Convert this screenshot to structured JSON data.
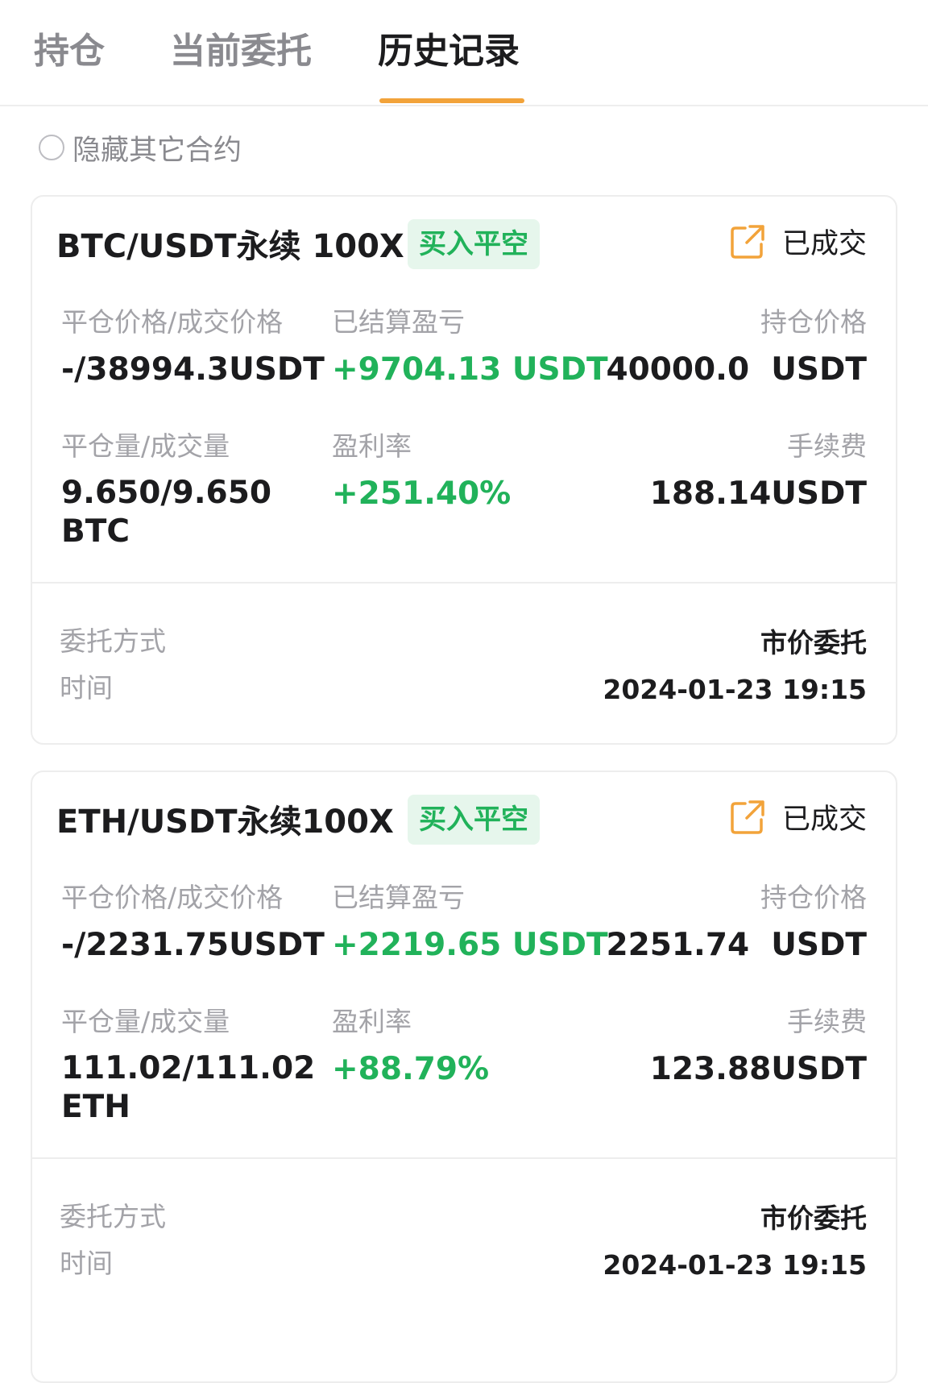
{
  "tabs": [
    {
      "label": "持仓"
    },
    {
      "label": "当前委托"
    },
    {
      "label": "历史记录"
    }
  ],
  "active_tab_index": 2,
  "filter": {
    "label": "隐藏其它合约",
    "checked": false
  },
  "labels": {
    "close_price": "平仓价格/成交价格",
    "settled_pnl": "已结算盈亏",
    "position_price": "持仓价格",
    "close_amount": "平仓量/成交量",
    "profit_rate": "盈利率",
    "fee": "手续费",
    "order_type": "委托方式",
    "time": "时间"
  },
  "colors": {
    "accent": "#f2a33a",
    "profit": "#21b25a",
    "tag_bg": "#e6f6ec"
  },
  "orders": [
    {
      "pair": "BTC/USDT永续 100X",
      "side": "买入平空",
      "status": "已成交",
      "status_icon": "share-external-icon",
      "close_price": "-/38994.3USDT",
      "settled_pnl": "+9704.13 USDT",
      "position_price": "40000.0  USDT",
      "close_amount": "9.650/9.650 BTC",
      "profit_rate": "+251.40%",
      "fee": "188.14USDT",
      "order_type": "市价委托",
      "time": "2024-01-23 19:15"
    },
    {
      "pair": "ETH/USDT永续100X",
      "side": "买入平空",
      "status": "已成交",
      "status_icon": "share-external-icon",
      "close_price": "-/2231.75USDT",
      "settled_pnl": "+2219.65 USDT",
      "position_price": "2251.74  USDT",
      "close_amount": "111.02/111.02 ETH",
      "profit_rate": "+88.79%",
      "fee": "123.88USDT",
      "order_type": "市价委托",
      "time": "2024-01-23 19:15"
    }
  ]
}
